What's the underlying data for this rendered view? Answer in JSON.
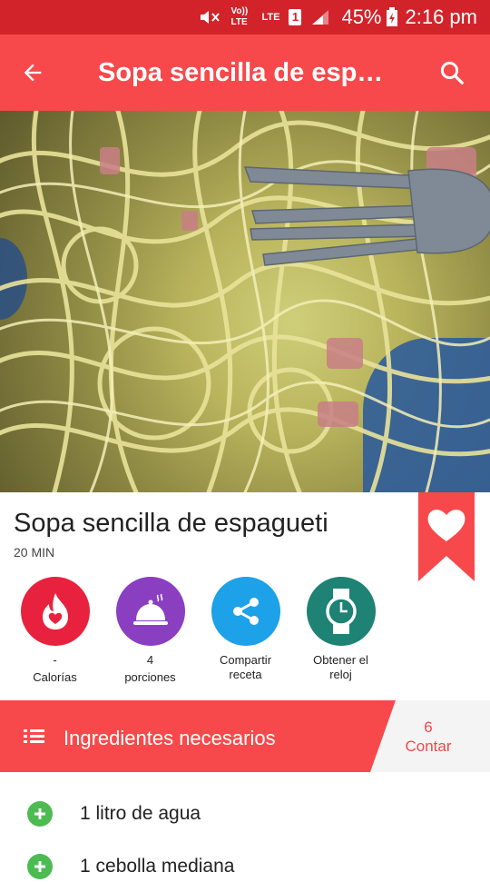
{
  "status_bar": {
    "battery": "45%",
    "time": "2:16 pm",
    "icons": [
      "mute-icon",
      "volte-icon",
      "lte-data-icon",
      "sim1-icon",
      "signal-icon",
      "battery-charging-icon"
    ],
    "volte_text": "Vo)) LTE",
    "lte_text": "LTE",
    "sim_text": "1"
  },
  "app_bar": {
    "title": "Sopa sencilla de espag…",
    "back_icon": "arrow-back-icon",
    "search_icon": "search-icon",
    "color": "#f7494b"
  },
  "recipe": {
    "name": "Sopa sencilla de espagueti",
    "time": "20 MIN",
    "favorite_icon": "heart-icon"
  },
  "actions": [
    {
      "icon": "flame-heart-icon",
      "line1": "-",
      "line2": "Calorías",
      "color": "#e8223e"
    },
    {
      "icon": "cloche-icon",
      "line1": "4",
      "line2": "porciones",
      "color": "#8a3fc0"
    },
    {
      "icon": "share-icon",
      "line1": "Compartir",
      "line2": "receta",
      "color": "#1da1e8"
    },
    {
      "icon": "watch-icon",
      "line1": "Obtener el",
      "line2": "reloj",
      "color": "#1e8274"
    }
  ],
  "ingredients": {
    "header": "Ingredientes necesarios",
    "count": "6",
    "count_label": "Contar",
    "items": [
      {
        "text": "1 litro de agua"
      },
      {
        "text": "1 cebolla mediana"
      }
    ]
  },
  "colors": {
    "status_bar": "#d2232a",
    "accent": "#f7494b",
    "plus": "#4cbb52"
  }
}
